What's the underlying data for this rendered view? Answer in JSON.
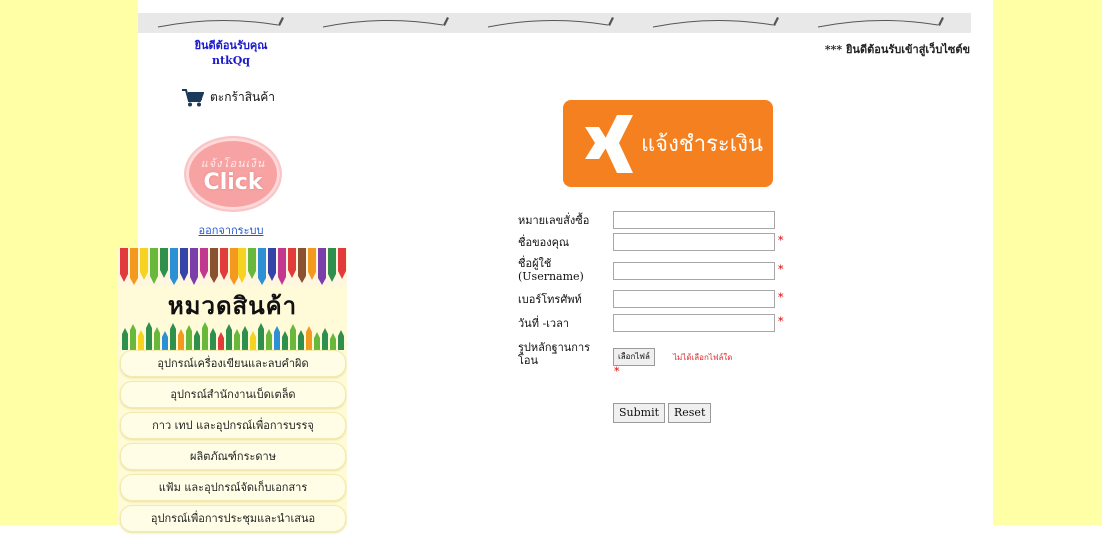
{
  "welcome": {
    "greeting": "ยินดีต้อนรับคุณ",
    "username": "ntkQq",
    "site_message": "*** ยินดีต้อนรับเข้าสู่เว็บไซต์ข"
  },
  "sidebar": {
    "cart_label": "ตะกร้าสินค้า",
    "pay_button": {
      "small_text": "แจ้งโอนเงิน",
      "big_text": "Click"
    },
    "logout_label": "ออกจากระบบ",
    "category_title": "หมวดสินค้า",
    "categories": [
      "อุปกรณ์เครื่องเขียนและลบคำผิด",
      "อุปกรณ์สำนักงานเบ็ดเตล็ด",
      "กาว เทป และอุปกรณ์เพื่อการบรรจุ",
      "ผลิตภัณฑ์กระดาษ",
      "แฟ้ม และอุปกรณ์จัดเก็บเอกสาร",
      "อุปกรณ์เพื่อการประชุมและนำเสนอ"
    ]
  },
  "main": {
    "logo_text": "แจ้งชำระเงิน",
    "form": {
      "order_number_label": "หมายเลขสั่งซื้อ",
      "order_number_value": "",
      "your_name_label": "ชื่อของคุณ",
      "your_name_value": "",
      "username_label_line1": "ชื่อผู้ใช้",
      "username_label_line2": "(Username)",
      "username_value": "",
      "phone_label": "เบอร์โทรศัพท์",
      "phone_value": "",
      "datetime_label": "วันที่ -เวลา",
      "datetime_value": "",
      "proof_label_line1": "รูปหลักฐานการ",
      "proof_label_line2": "โอน",
      "file_button_label": "เลือกไฟล์",
      "file_status": "ไม่ได้เลือกไฟล์ใด",
      "required_mark": "*",
      "submit_label": "Submit",
      "reset_label": "Reset"
    }
  },
  "colors": {
    "page_side": "#ffffa6",
    "logo_orange": "#f4801f",
    "required_red": "#dd0000",
    "link_blue": "#2255cc"
  },
  "icons": [
    "cart-icon",
    "x-logo-icon"
  ]
}
